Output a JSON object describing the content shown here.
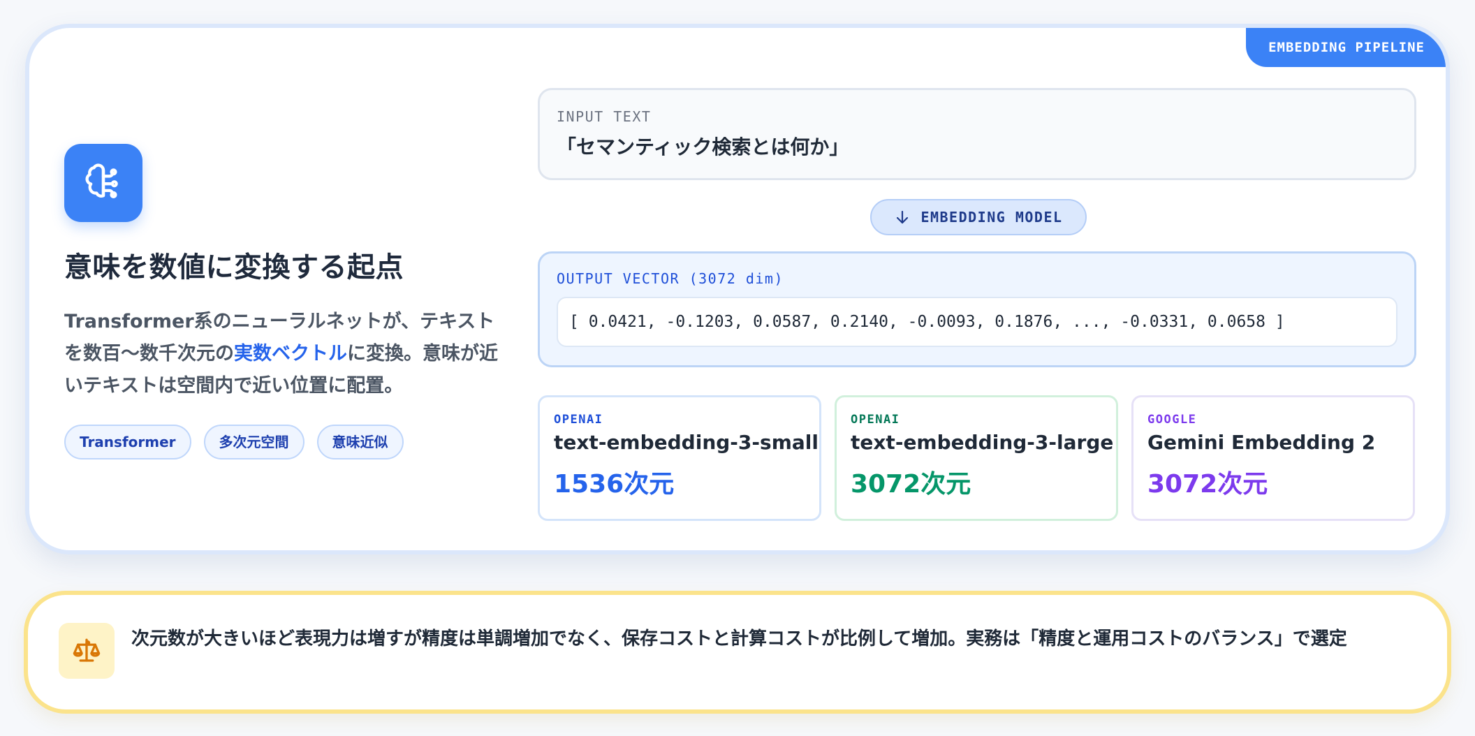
{
  "badge": "EMBEDDING PIPELINE",
  "left": {
    "icon": "brain-icon",
    "headline": "意味を数値に変換する起点",
    "description_part1": "Transformer系のニューラルネットが、テキストを数百〜数千次元の",
    "description_highlight": "実数ベクトル",
    "description_part2": "に変換。意味が近いテキストは空間内で近い位置に配置。",
    "tags": [
      "Transformer",
      "多次元空間",
      "意味近似"
    ]
  },
  "input": {
    "label": "INPUT TEXT",
    "value": "「セマンティック検索とは何か」"
  },
  "model_step": {
    "icon": "arrow-down-icon",
    "label": "EMBEDDING MODEL"
  },
  "output": {
    "label": "OUTPUT VECTOR (3072 dim)",
    "vector": "[ 0.0421, -0.1203, 0.0587, 0.2140, -0.0093, 0.1876, ..., -0.0331, 0.0658 ]"
  },
  "models": [
    {
      "provider": "OPENAI",
      "name": "text-embedding-3-small",
      "dims": "1536次元",
      "color": "#2563eb"
    },
    {
      "provider": "OPENAI",
      "name": "text-embedding-3-large",
      "dims": "3072次元",
      "color": "#059669"
    },
    {
      "provider": "GOOGLE",
      "name": "Gemini Embedding 2",
      "dims": "3072次元",
      "color": "#7c3aed"
    }
  ],
  "note": {
    "icon": "scale-icon",
    "text": "次元数が大きいほど表現力は増すが精度は単調増加でなく、保存コストと計算コストが比例して増加。実務は「精度と運用コストのバランス」で選定"
  },
  "colors": {
    "accent": "#3b82f6",
    "warning_border": "#fbe38b"
  }
}
